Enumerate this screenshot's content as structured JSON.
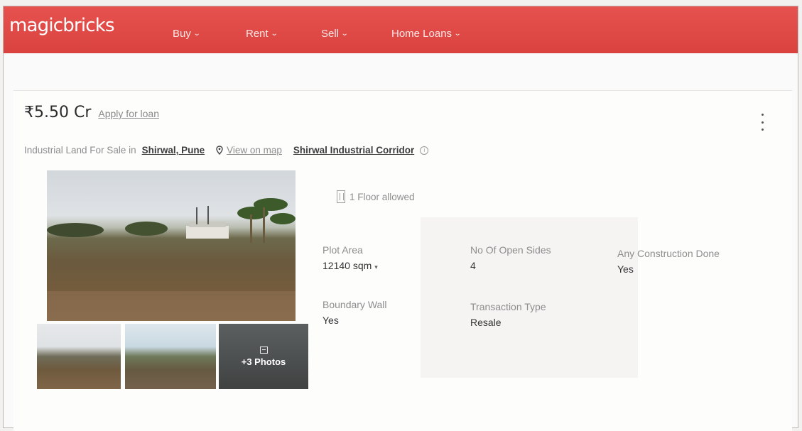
{
  "header": {
    "logo": "magicbricks",
    "nav": [
      {
        "label": "Buy"
      },
      {
        "label": "Rent"
      },
      {
        "label": "Sell"
      },
      {
        "label": "Home Loans"
      }
    ]
  },
  "listing": {
    "price": "₹5.50 Cr",
    "loan_link": "Apply for loan",
    "subtitle_prefix": "Industrial Land For Sale in",
    "location": "Shirwal, Pune",
    "map_link": "View on map",
    "corridor": "Shirwal Industrial Corridor",
    "more_photos": "+3 Photos",
    "floors": "1 Floor allowed"
  },
  "summary": {
    "plot_area": {
      "label": "Plot Area",
      "value": "12140 sqm"
    },
    "open_sides": {
      "label": "No Of Open Sides",
      "value": "4"
    },
    "construction": {
      "label": "Any Construction Done",
      "value": "Yes"
    },
    "boundary_wall": {
      "label": "Boundary Wall",
      "value": "Yes"
    },
    "transaction": {
      "label": "Transaction Type",
      "value": "Resale"
    }
  },
  "colors": {
    "brand": "#d9423f",
    "text": "#333333",
    "muted": "#8d8d8d"
  }
}
